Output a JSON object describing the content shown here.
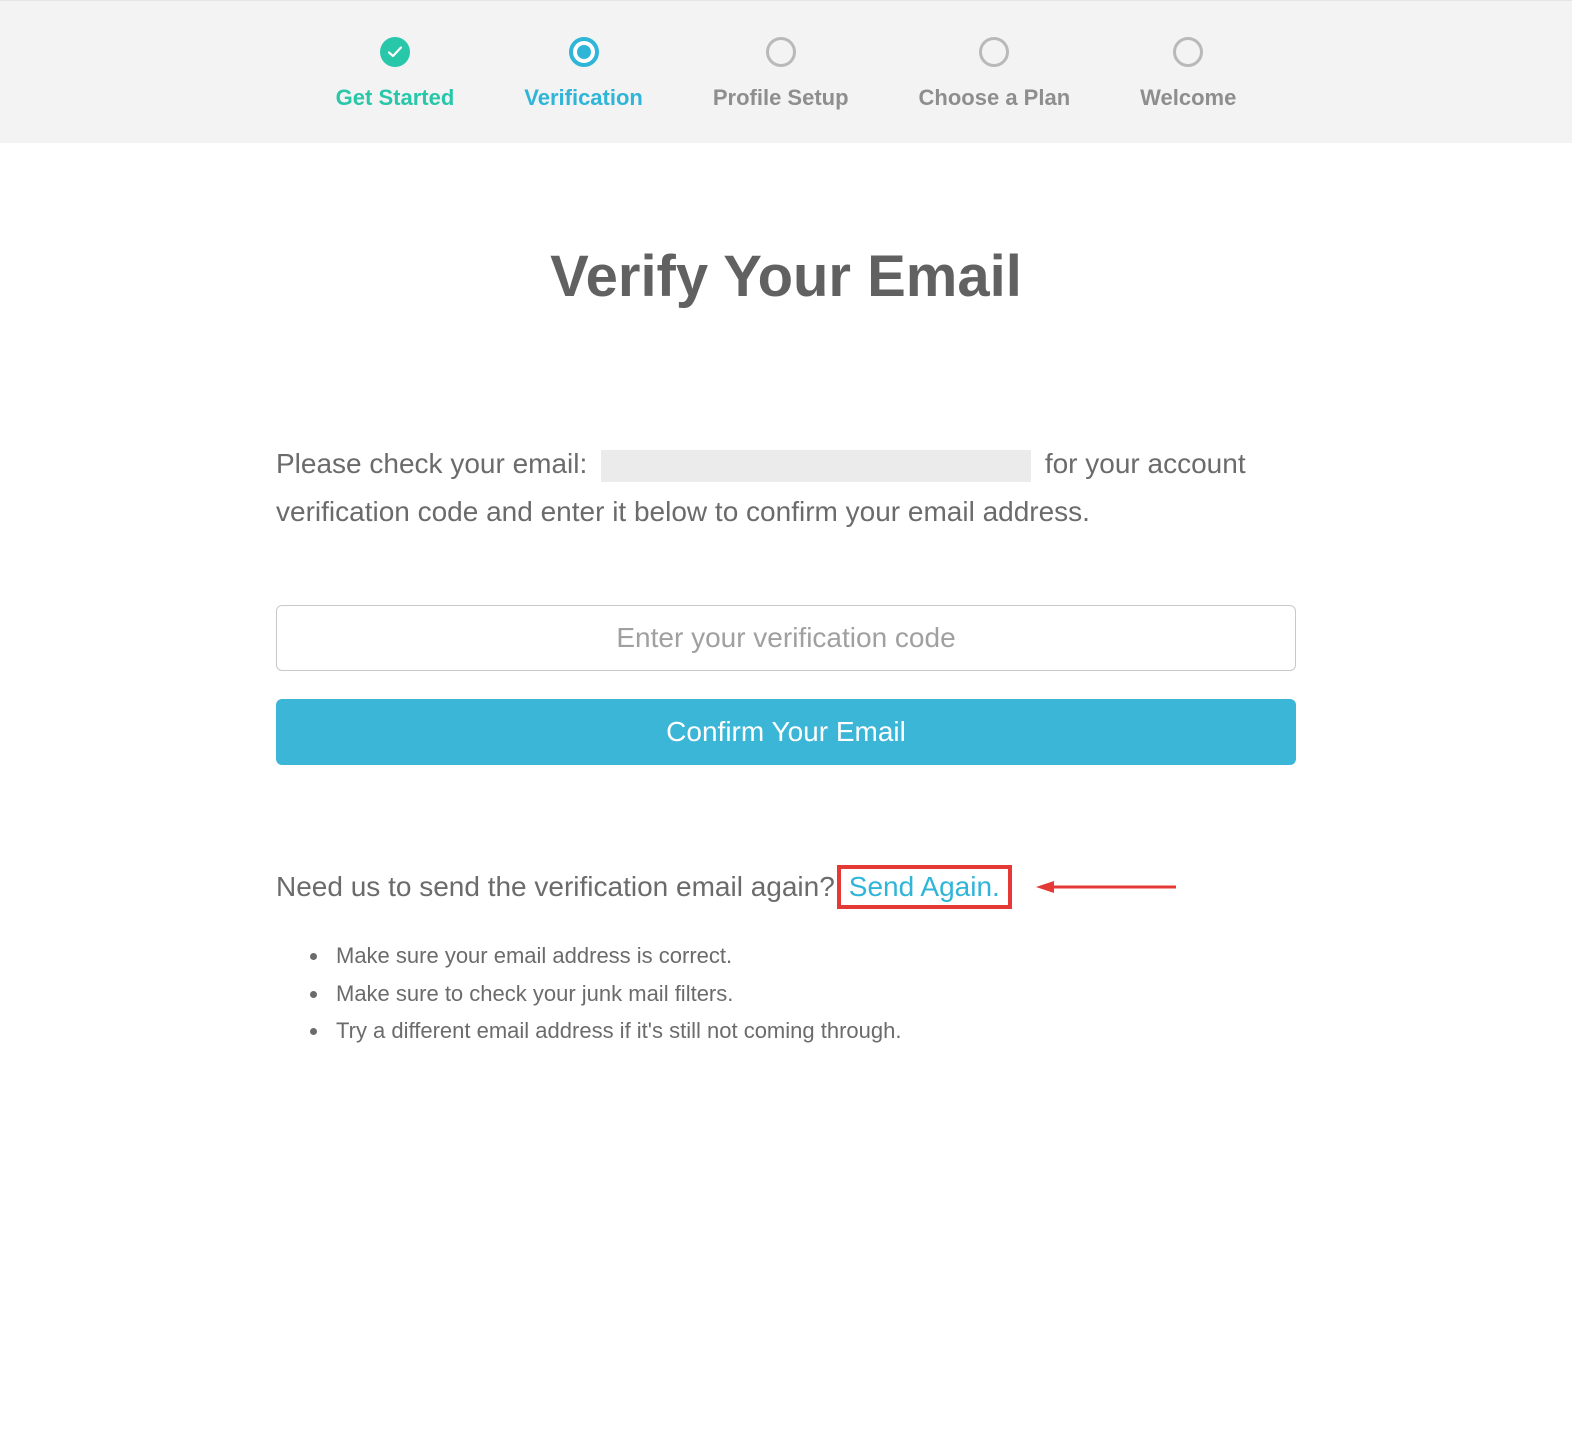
{
  "stepper": {
    "steps": [
      {
        "label": "Get Started",
        "state": "completed"
      },
      {
        "label": "Verification",
        "state": "active"
      },
      {
        "label": "Profile Setup",
        "state": "pending"
      },
      {
        "label": "Choose a Plan",
        "state": "pending"
      },
      {
        "label": "Welcome",
        "state": "pending"
      }
    ]
  },
  "main": {
    "title": "Verify Your Email",
    "instruction_before": "Please check your email: ",
    "instruction_after": " for your account verification code and enter it below to confirm your email address.",
    "code_placeholder": "Enter your verification code",
    "confirm_label": "Confirm Your Email",
    "resend_prompt": "Need us to send the verification email again?",
    "resend_link": "Send Again.",
    "tips": [
      "Make sure your email address is correct.",
      "Make sure to check your junk mail filters.",
      "Try a different email address if it's still not coming through."
    ]
  }
}
